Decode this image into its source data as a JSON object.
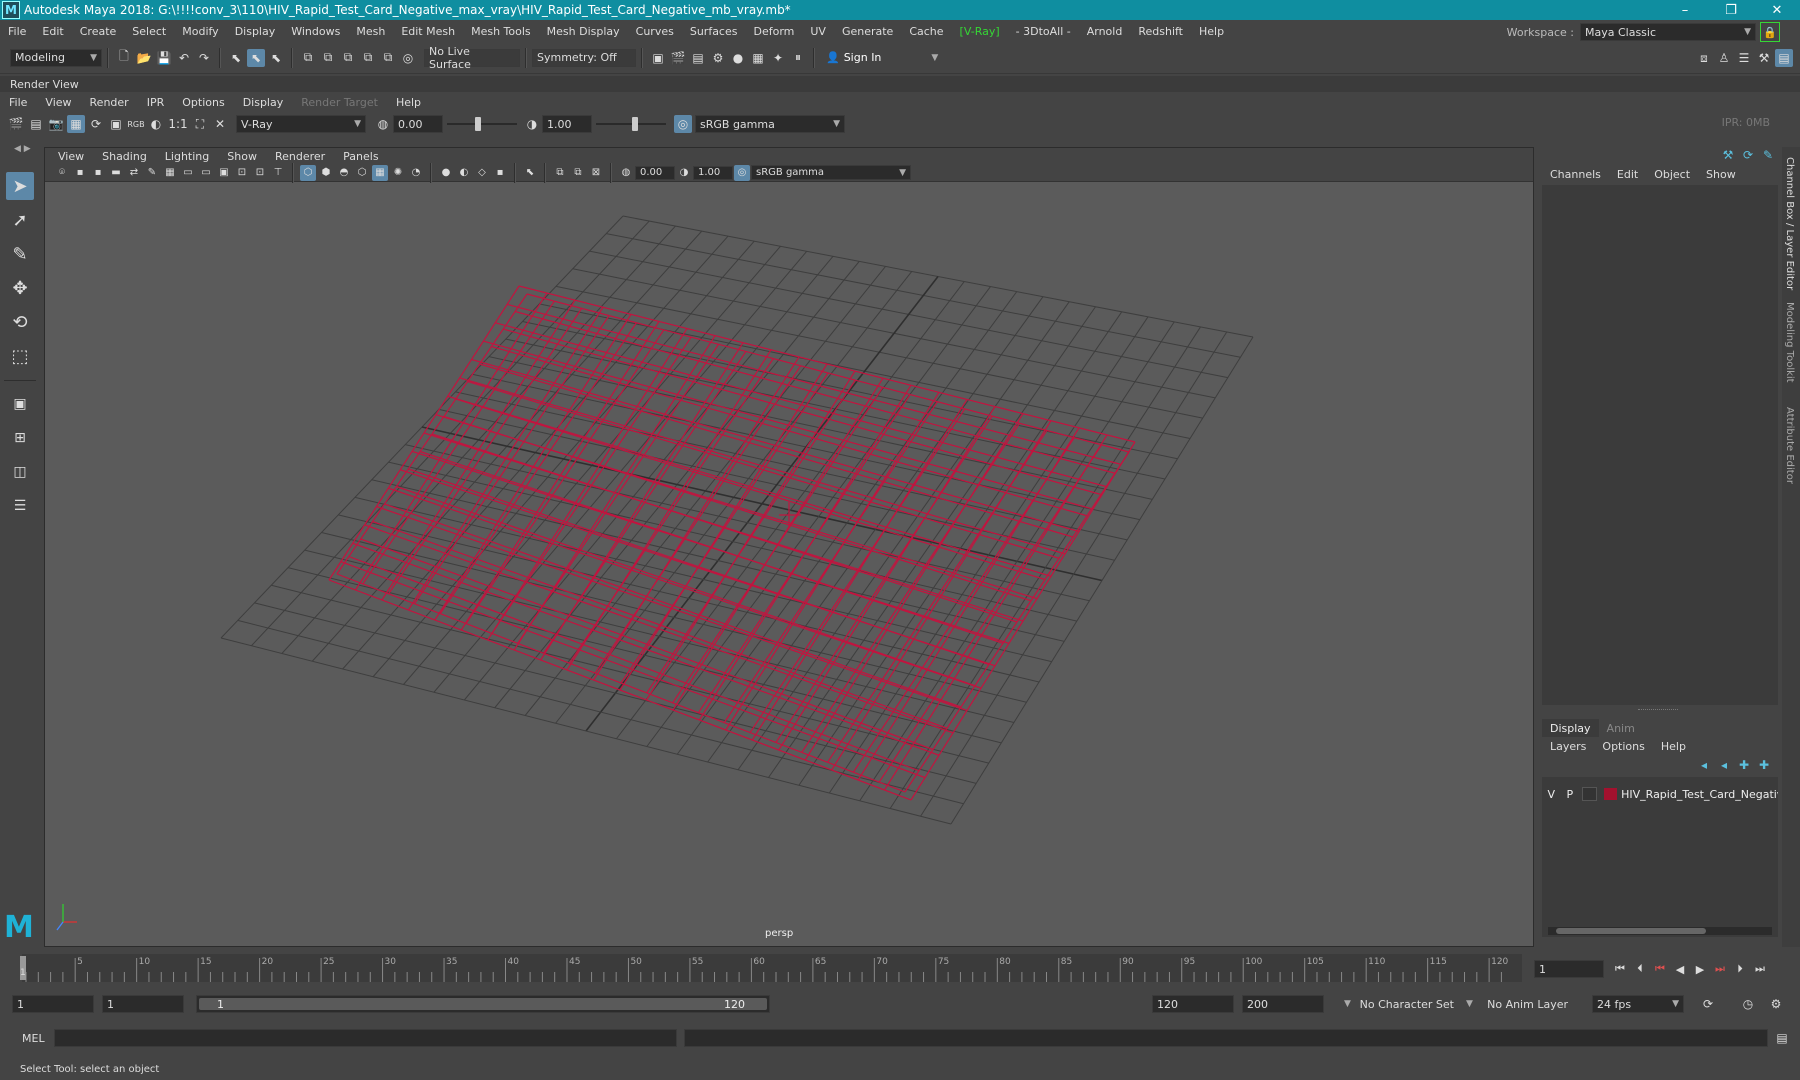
{
  "window": {
    "title": "Autodesk Maya 2018: G:\\!!!!conv_3\\110\\HIV_Rapid_Test_Card_Negative_max_vray\\HIV_Rapid_Test_Card_Negative_mb_vray.mb*",
    "minimize": "–",
    "restore": "❐",
    "close": "✕"
  },
  "menu": [
    "File",
    "Edit",
    "Create",
    "Select",
    "Modify",
    "Display",
    "Windows",
    "Mesh",
    "Edit Mesh",
    "Mesh Tools",
    "Mesh Display",
    "Curves",
    "Surfaces",
    "Deform",
    "UV",
    "Generate",
    "Cache",
    "[V-Ray]",
    "- 3DtoAll -",
    "Arnold",
    "Redshift",
    "Help"
  ],
  "workspace": {
    "label": "Workspace :",
    "value": "Maya Classic"
  },
  "statusline": {
    "menuset": "Modeling",
    "live_surface": "No Live Surface",
    "symmetry": "Symmetry: Off",
    "sign_in": "Sign In"
  },
  "render_view": {
    "title": "Render View",
    "menu": [
      "File",
      "View",
      "Render",
      "IPR",
      "Options",
      "Display",
      "Render Target",
      "Help"
    ],
    "renderer": "V-Ray",
    "exposure": "0.00",
    "gamma": "1.00",
    "colorspace": "sRGB gamma",
    "ratio": "1:1",
    "rgb": "RGB",
    "ipr_status": "IPR: 0MB"
  },
  "viewport": {
    "menu": [
      "View",
      "Shading",
      "Lighting",
      "Show",
      "Renderer",
      "Panels"
    ],
    "exposure": "0.00",
    "gamma": "1.00",
    "colorspace": "sRGB gamma",
    "camera": "persp"
  },
  "channel_box": {
    "menu": [
      "Channels",
      "Edit",
      "Object",
      "Show"
    ]
  },
  "layer_editor": {
    "tabs": [
      "Display",
      "Anim"
    ],
    "menu": [
      "Layers",
      "Options",
      "Help"
    ],
    "layer": {
      "v": "V",
      "p": "P",
      "name": "HIV_Rapid_Test_Card_Negative",
      "color": "#a3112e"
    }
  },
  "side_tabs": [
    "Channel Box / Layer Editor",
    "Modeling Toolkit",
    "Attribute Editor"
  ],
  "timeline": {
    "ticks": [
      "5",
      "10",
      "15",
      "20",
      "25",
      "30",
      "35",
      "40",
      "45",
      "50",
      "55",
      "60",
      "65",
      "70",
      "75",
      "80",
      "85",
      "90",
      "95",
      "100",
      "105",
      "110",
      "115",
      "120"
    ],
    "current_marker": "1",
    "current_frame": "1"
  },
  "range": {
    "start": "1",
    "playback_start": "1",
    "range_start_label": "1",
    "range_end_label": "120",
    "playback_end": "120",
    "end": "200",
    "character_set": "No Character Set",
    "anim_layer": "No Anim Layer",
    "fps": "24 fps"
  },
  "command_line": {
    "label": "MEL"
  },
  "help_line": "Select Tool: select an object",
  "colors": {
    "titlebar": "#0f8ea0",
    "active_tool": "#5d88a8",
    "selection_wire": "#c2143f",
    "vray": "#35d735"
  }
}
